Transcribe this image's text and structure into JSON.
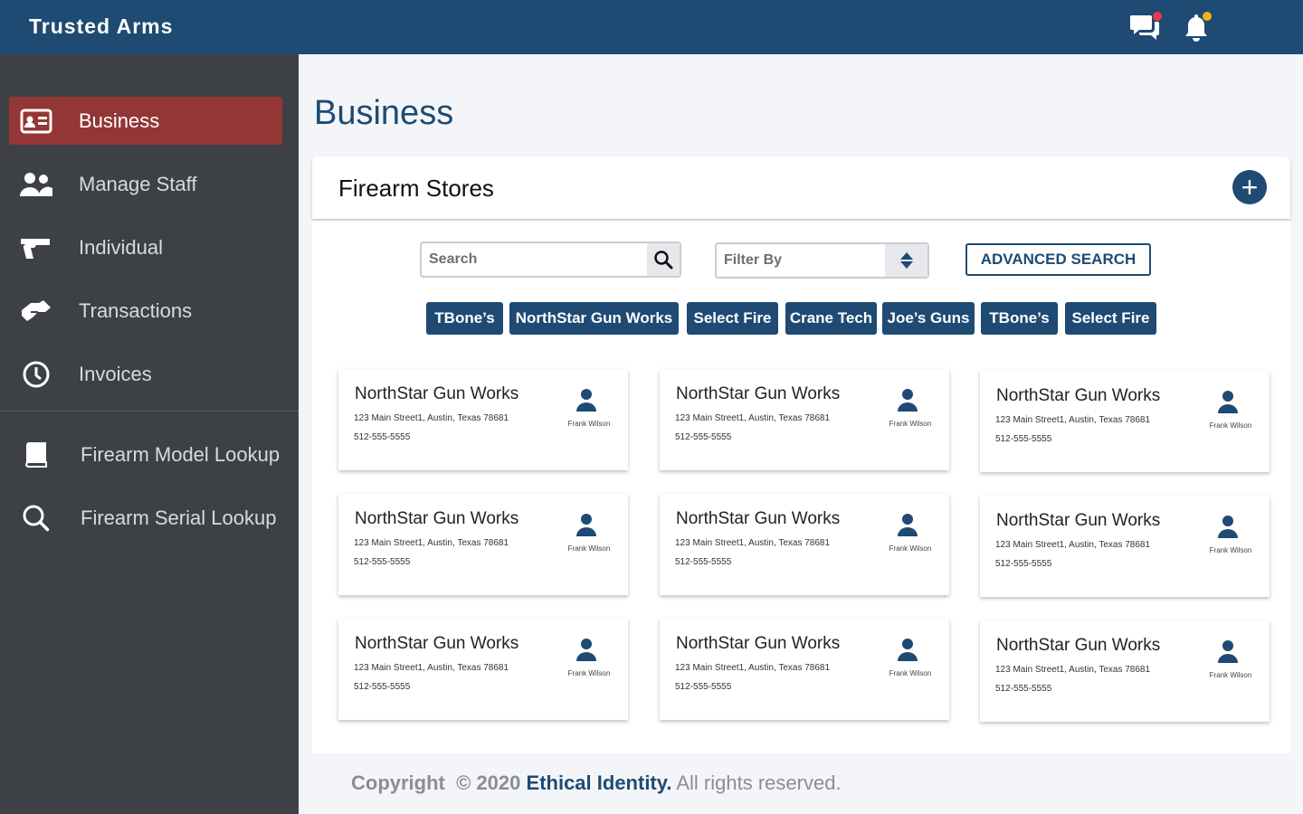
{
  "app": {
    "title": "Trusted Arms"
  },
  "topbar": {
    "messages_icon": "chat-bubbles-icon",
    "notifications_icon": "bell-icon",
    "badge_colors": {
      "messages": "#e8394a",
      "notifications": "#f2b411"
    }
  },
  "sidebar": {
    "items": [
      {
        "label": "Business",
        "icon": "id-card-icon",
        "active": true
      },
      {
        "label": "Manage Staff",
        "icon": "users-icon"
      },
      {
        "label": "Individual",
        "icon": "handgun-icon"
      },
      {
        "label": "Transactions",
        "icon": "handshake-icon"
      },
      {
        "label": "Invoices",
        "icon": "clock-icon"
      },
      {
        "label": "Firearm Model Lookup",
        "icon": "book-icon"
      },
      {
        "label": "Firearm Serial Lookup",
        "icon": "search-icon"
      }
    ]
  },
  "page": {
    "title": "Business"
  },
  "panel": {
    "title": "Firearm Stores",
    "add_symbol": "+",
    "search": {
      "placeholder": "Search",
      "value": ""
    },
    "filter": {
      "placeholder": "Filter By",
      "value": ""
    },
    "advanced_search_label": "ADVANCED SEARCH",
    "chips": [
      "TBone’s",
      "NorthStar Gun Works",
      "Select Fire",
      "Crane Tech",
      "Joe’s Guns",
      "TBone’s",
      "Select Fire"
    ],
    "cards": [
      {
        "name": "NorthStar Gun Works",
        "address": "123 Main Street1, Austin, Texas 78681",
        "phone": "512-555-5555",
        "owner": "Frank Wilson"
      },
      {
        "name": "NorthStar Gun Works",
        "address": "123 Main Street1, Austin, Texas 78681",
        "phone": "512-555-5555",
        "owner": "Frank Wilson"
      },
      {
        "name": "NorthStar Gun Works",
        "address": "123 Main Street1, Austin, Texas 78681",
        "phone": "512-555-5555",
        "owner": "Frank Wilson"
      },
      {
        "name": "NorthStar Gun Works",
        "address": "123 Main Street1, Austin, Texas 78681",
        "phone": "512-555-5555",
        "owner": "Frank Wilson"
      },
      {
        "name": "NorthStar Gun Works",
        "address": "123 Main Street1, Austin, Texas 78681",
        "phone": "512-555-5555",
        "owner": "Frank Wilson"
      },
      {
        "name": "NorthStar Gun Works",
        "address": "123 Main Street1, Austin, Texas 78681",
        "phone": "512-555-5555",
        "owner": "Frank Wilson"
      },
      {
        "name": "NorthStar Gun Works",
        "address": "123 Main Street1, Austin, Texas 78681",
        "phone": "512-555-5555",
        "owner": "Frank Wilson"
      },
      {
        "name": "NorthStar Gun Works",
        "address": "123 Main Street1, Austin, Texas 78681",
        "phone": "512-555-5555",
        "owner": "Frank Wilson"
      },
      {
        "name": "NorthStar Gun Works",
        "address": "123 Main Street1, Austin, Texas 78681",
        "phone": "512-555-5555",
        "owner": "Frank Wilson"
      }
    ]
  },
  "footer": {
    "copyright": "Copyright",
    "year": "© 2020",
    "company": "Ethical Identity.",
    "rights": "All rights reserved."
  },
  "colors": {
    "primary": "#1e4a73",
    "active_nav": "#943636",
    "sidebar": "#3d4145"
  }
}
